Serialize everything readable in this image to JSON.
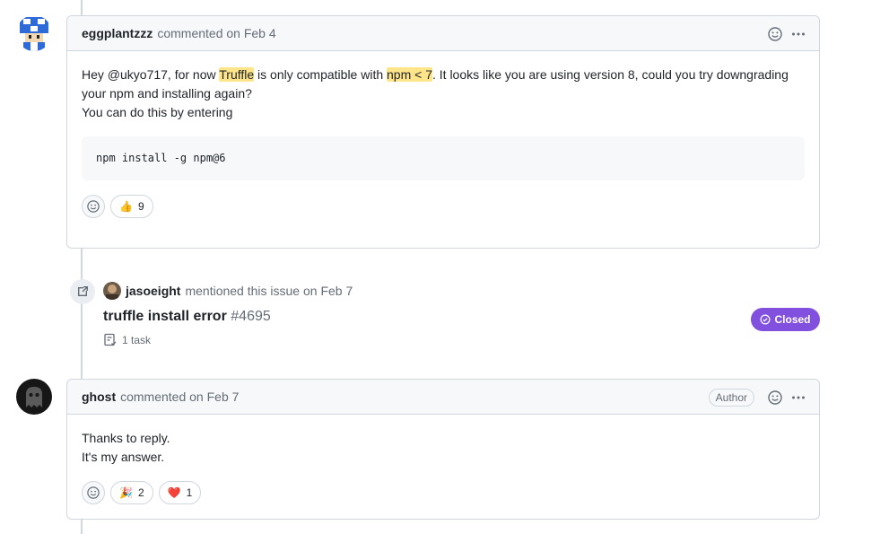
{
  "comment1": {
    "author": "eggplantzzz",
    "action": "commented on Feb 4",
    "body": {
      "part1": "Hey @ukyo717, for now ",
      "highlight1": "Truffle",
      "part2": " is only compatible with ",
      "highlight2": "npm < 7",
      "part3": ". It looks like you are using version 8, could you try downgrading your npm and installing again?",
      "line2": "You can do this by entering"
    },
    "code": "npm install -g npm@6",
    "reactions": [
      {
        "icon": "thumbs-up",
        "emoji": "👍",
        "count": "9"
      }
    ]
  },
  "event": {
    "actor": "jasoeight",
    "action": "mentioned this issue on Feb 7",
    "issue_title": "truffle install error",
    "issue_number": "#4695",
    "task": "1 task",
    "status": "Closed",
    "status_color": "#8250df"
  },
  "comment2": {
    "author": "ghost",
    "action": "commented on Feb 7",
    "badge": "Author",
    "line1": "Thanks to reply.",
    "line2": "It's my answer.",
    "reactions": [
      {
        "icon": "party-popper",
        "emoji": "🎉",
        "count": "2"
      },
      {
        "icon": "heart",
        "emoji": "❤️",
        "count": "1"
      }
    ]
  }
}
